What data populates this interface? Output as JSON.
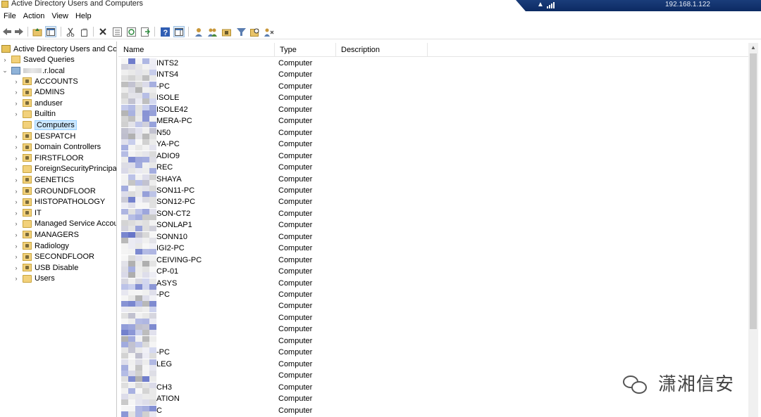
{
  "window": {
    "title": "Active Directory Users and Computers",
    "ip": "192.168.1.122"
  },
  "menu": [
    "File",
    "Action",
    "View",
    "Help"
  ],
  "toolbar": {
    "icons": [
      "back-icon",
      "forward-icon",
      "up-folder-icon",
      "show-console-tree-icon",
      "cut-icon",
      "copy-icon",
      "delete-icon",
      "properties-icon",
      "refresh-icon",
      "export-list-icon",
      "help-icon",
      "show-action-pane-icon",
      "new-user-icon",
      "new-group-icon",
      "new-ou-icon",
      "filter-icon",
      "find-icon",
      "add-to-group-icon"
    ]
  },
  "tree": {
    "root": "Active Directory Users and Com",
    "saved_queries": "Saved Queries",
    "domain_suffix": ".r.local",
    "items": [
      {
        "label": "ACCOUNTS",
        "kind": "ou",
        "selected": false
      },
      {
        "label": "ADMINS",
        "kind": "ou",
        "selected": false
      },
      {
        "label": "anduser",
        "kind": "ou",
        "selected": false
      },
      {
        "label": "Builtin",
        "kind": "folder",
        "selected": false
      },
      {
        "label": "Computers",
        "kind": "folder",
        "selected": true
      },
      {
        "label": "DESPATCH",
        "kind": "ou",
        "selected": false
      },
      {
        "label": "Domain Controllers",
        "kind": "ou",
        "selected": false
      },
      {
        "label": "FIRSTFLOOR",
        "kind": "ou",
        "selected": false
      },
      {
        "label": "ForeignSecurityPrincipals",
        "kind": "folder",
        "selected": false
      },
      {
        "label": "GENETICS",
        "kind": "ou",
        "selected": false
      },
      {
        "label": "GROUNDFLOOR",
        "kind": "ou",
        "selected": false
      },
      {
        "label": "HISTOPATHOLOGY",
        "kind": "ou",
        "selected": false
      },
      {
        "label": "IT",
        "kind": "ou",
        "selected": false
      },
      {
        "label": "Managed Service Accounts",
        "kind": "folder",
        "selected": false
      },
      {
        "label": "MANAGERS",
        "kind": "ou",
        "selected": false
      },
      {
        "label": "Radiology",
        "kind": "ou",
        "selected": false
      },
      {
        "label": "SECONDFLOOR",
        "kind": "ou",
        "selected": false
      },
      {
        "label": "USB Disable",
        "kind": "ou",
        "selected": false
      },
      {
        "label": "Users",
        "kind": "folder",
        "selected": false
      }
    ]
  },
  "list": {
    "columns": [
      "Name",
      "Type",
      "Description"
    ],
    "rows": [
      {
        "name": "INTS2",
        "type": "Computer"
      },
      {
        "name": "INTS4",
        "type": "Computer"
      },
      {
        "name": "-PC",
        "type": "Computer"
      },
      {
        "name": "ISOLE",
        "type": "Computer"
      },
      {
        "name": "ISOLE42",
        "type": "Computer"
      },
      {
        "name": "MERA-PC",
        "type": "Computer"
      },
      {
        "name": "N50",
        "type": "Computer"
      },
      {
        "name": "YA-PC",
        "type": "Computer"
      },
      {
        "name": "ADIO9",
        "type": "Computer"
      },
      {
        "name": "REC",
        "type": "Computer"
      },
      {
        "name": "SHAYA",
        "type": "Computer"
      },
      {
        "name": "SON11-PC",
        "type": "Computer"
      },
      {
        "name": "SON12-PC",
        "type": "Computer"
      },
      {
        "name": "SON-CT2",
        "type": "Computer"
      },
      {
        "name": "SONLAP1",
        "type": "Computer"
      },
      {
        "name": "SONN10",
        "type": "Computer"
      },
      {
        "name": "IGI2-PC",
        "type": "Computer"
      },
      {
        "name": "CEIVING-PC",
        "type": "Computer"
      },
      {
        "name": "CP-01",
        "type": "Computer"
      },
      {
        "name": "ASYS",
        "type": "Computer"
      },
      {
        "name": "-PC",
        "type": "Computer"
      },
      {
        "name": "",
        "type": "Computer"
      },
      {
        "name": "",
        "type": "Computer"
      },
      {
        "name": "",
        "type": "Computer"
      },
      {
        "name": "",
        "type": "Computer"
      },
      {
        "name": "-PC",
        "type": "Computer"
      },
      {
        "name": "LEG",
        "type": "Computer"
      },
      {
        "name": "",
        "type": "Computer"
      },
      {
        "name": "CH3",
        "type": "Computer"
      },
      {
        "name": "ATION",
        "type": "Computer"
      },
      {
        "name": "C",
        "type": "Computer"
      }
    ]
  },
  "watermark": {
    "text": "潇湘信安"
  }
}
